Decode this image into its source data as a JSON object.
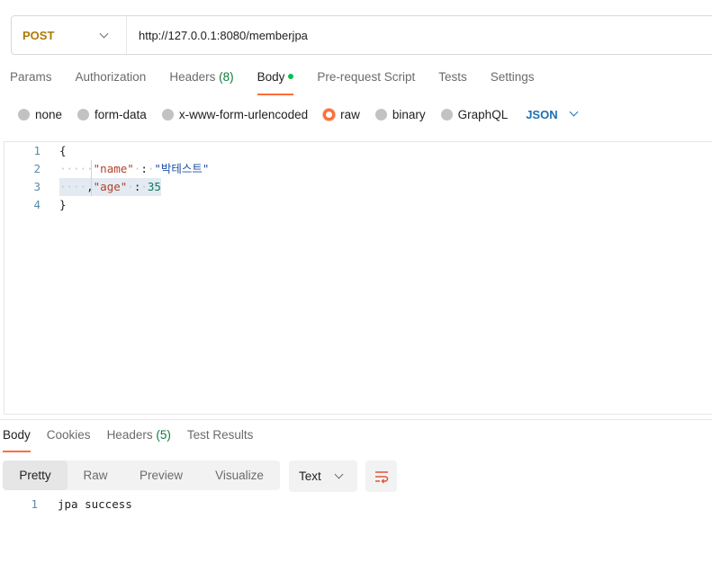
{
  "request": {
    "method": "POST",
    "url": "http://127.0.0.1:8080/memberjpa"
  },
  "request_tabs": [
    {
      "label": "Params"
    },
    {
      "label": "Authorization"
    },
    {
      "label": "Headers",
      "count": "(8)"
    },
    {
      "label": "Body",
      "active": true
    },
    {
      "label": "Pre-request Script"
    },
    {
      "label": "Tests"
    },
    {
      "label": "Settings"
    }
  ],
  "body_modes": [
    {
      "label": "none",
      "selected": false
    },
    {
      "label": "form-data",
      "selected": false
    },
    {
      "label": "x-www-form-urlencoded",
      "selected": false
    },
    {
      "label": "raw",
      "selected": true
    },
    {
      "label": "binary",
      "selected": false
    },
    {
      "label": "GraphQL",
      "selected": false
    }
  ],
  "raw_format": "JSON",
  "editor": {
    "lines": [
      {
        "number": "1",
        "text": "{"
      },
      {
        "number": "2",
        "key": "\"name\"",
        "sep": ":",
        "value": "\"박테스트\""
      },
      {
        "number": "3",
        "prefix": ",",
        "key": "\"age\"",
        "sep": ":",
        "value": "35"
      },
      {
        "number": "4",
        "text": "}"
      }
    ]
  },
  "response_tabs": [
    {
      "label": "Body",
      "active": true
    },
    {
      "label": "Cookies"
    },
    {
      "label": "Headers",
      "count": "(5)"
    },
    {
      "label": "Test Results"
    }
  ],
  "response_views": [
    {
      "label": "Pretty",
      "active": true
    },
    {
      "label": "Raw"
    },
    {
      "label": "Preview"
    },
    {
      "label": "Visualize"
    }
  ],
  "response_format": "Text",
  "response_body": {
    "number": "1",
    "text": "jpa success"
  },
  "icons": {
    "method_dropdown": "chevron-down-icon",
    "format_dropdown": "chevron-down-icon",
    "wrap": "wrap-lines-icon"
  },
  "colors": {
    "accent": "#ff6c37",
    "method_post": "#ad7a03",
    "json_link": "#1c6fb3",
    "count_green": "#0f7a3a",
    "body_dot": "#0cbb52"
  }
}
